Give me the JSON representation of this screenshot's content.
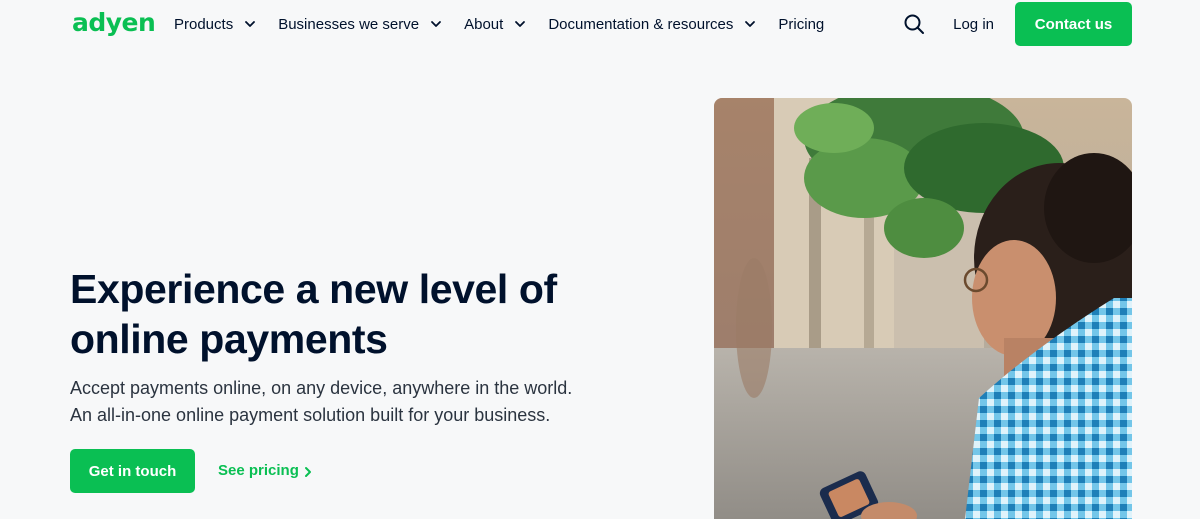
{
  "nav": {
    "logo_text": "adyen",
    "menu": [
      {
        "label": "Products",
        "has_dropdown": true
      },
      {
        "label": "Businesses we serve",
        "has_dropdown": true
      },
      {
        "label": "About",
        "has_dropdown": true
      },
      {
        "label": "Documentation & resources",
        "has_dropdown": true
      },
      {
        "label": "Pricing",
        "has_dropdown": false
      }
    ],
    "search_icon": "search-icon",
    "login_label": "Log in",
    "contact_label": "Contact us"
  },
  "hero": {
    "title": "Experience a new level of online payments",
    "subtitle": "Accept payments online, on any device, anywhere in the world. An all-in-one online payment solution built for your business.",
    "primary_cta": "Get in touch",
    "secondary_cta": "See pricing"
  },
  "colors": {
    "brand_green": "#0abf53",
    "text_dark": "#00112c",
    "background": "#f7f8f9"
  }
}
